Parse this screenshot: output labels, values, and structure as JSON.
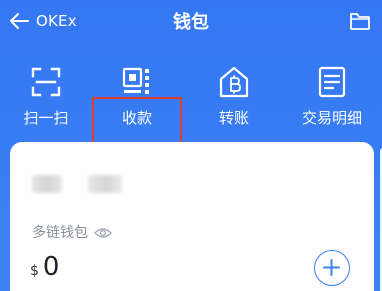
{
  "header": {
    "back_label": "OKEx",
    "title": "钱包",
    "icons": {
      "back": "back-arrow-icon",
      "folder": "folder-icon"
    }
  },
  "actions": [
    {
      "label": "扫一扫",
      "icon": "scan-icon"
    },
    {
      "label": "收款",
      "icon": "receive-qr-icon"
    },
    {
      "label": "转账",
      "icon": "transfer-icon"
    },
    {
      "label": "交易明细",
      "icon": "transaction-details-icon"
    }
  ],
  "highlight": {
    "target": "收款",
    "color": "#e13a2f"
  },
  "wallet": {
    "name": "多链钱包",
    "currency_symbol": "$",
    "balance": "0",
    "icons": {
      "visibility": "eye-icon",
      "add": "add-icon"
    }
  },
  "colors": {
    "header_bg": "#3577f3",
    "card_bg": "#ffffff",
    "accent": "#3b82f2",
    "highlight": "#e13a2f"
  }
}
